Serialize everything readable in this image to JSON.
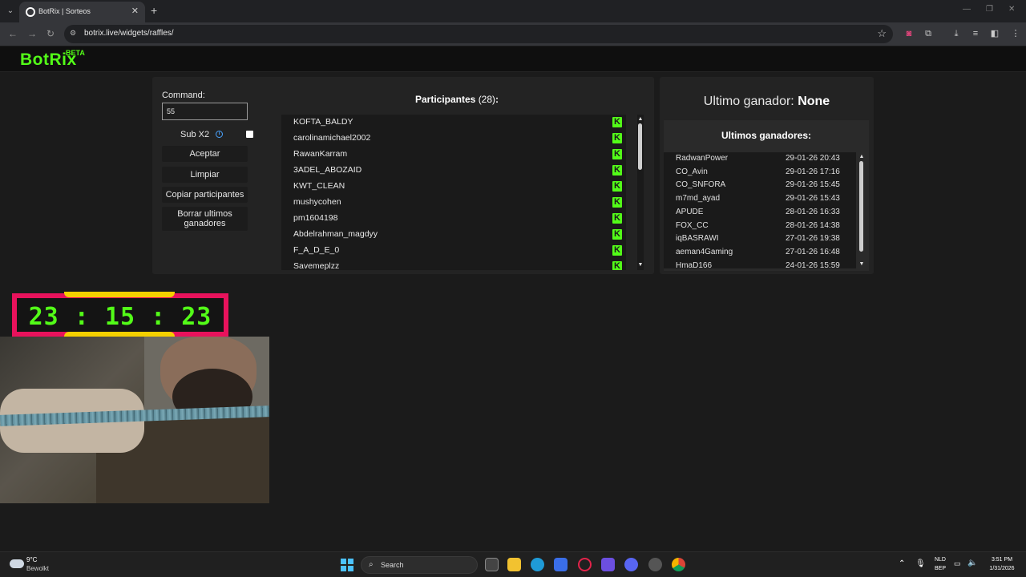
{
  "browser": {
    "tab_title": "BotRix | Sorteos",
    "url": "botrix.live/widgets/raffles/"
  },
  "site": {
    "logo": "BotRix",
    "logo_badge": "BETA"
  },
  "controls": {
    "command_label": "Command:",
    "command_value": "55",
    "subx2_label": "Sub X2",
    "subx2_checked": false,
    "accept_label": "Aceptar",
    "clear_label": "Limpiar",
    "copy_label": "Copiar participantes",
    "delete_winners_label": "Borrar ultimos ganadores"
  },
  "participants": {
    "title": "Participantes",
    "count": "(28)",
    "colon": ":",
    "list": [
      "KOFTA_BALDY",
      "carolinamichael2002",
      "RawanKarram",
      "3ADEL_ABOZAID",
      "KWT_CLEAN",
      "mushycohen",
      "pm1604198",
      "Abdelrahman_magdyy",
      "F_A_D_E_0",
      "Savemeplzz"
    ]
  },
  "winner": {
    "label": "Ultimo ganador:",
    "value": "None",
    "history_title": "Ultimos ganadores:",
    "history": [
      {
        "name": "RadwanPower",
        "date": "29-01-26 20:43"
      },
      {
        "name": "CO_Avin",
        "date": "29-01-26 17:16"
      },
      {
        "name": "CO_SNFORA",
        "date": "29-01-26 15:45"
      },
      {
        "name": "m7md_ayad",
        "date": "29-01-26 15:43"
      },
      {
        "name": "APUDE",
        "date": "28-01-26 16:33"
      },
      {
        "name": "FOX_CC",
        "date": "28-01-26 14:38"
      },
      {
        "name": "iqBASRAWI",
        "date": "27-01-26 19:38"
      },
      {
        "name": "aeman4Gaming",
        "date": "27-01-26 16:48"
      },
      {
        "name": "HmaD166",
        "date": "24-01-26 15:59"
      }
    ]
  },
  "timer": {
    "value": "23 : 15 : 23"
  },
  "taskbar": {
    "temperature": "9°C",
    "weather": "Bewolkt",
    "search_label": "Search",
    "lang_top": "NLD",
    "lang_bottom": "BEP",
    "time": "3:51 PM",
    "date": "1/31/2026"
  },
  "colors": {
    "brand": "#53fc18",
    "timer_frame": "#e8125c",
    "timer_tab": "#f5d000"
  }
}
